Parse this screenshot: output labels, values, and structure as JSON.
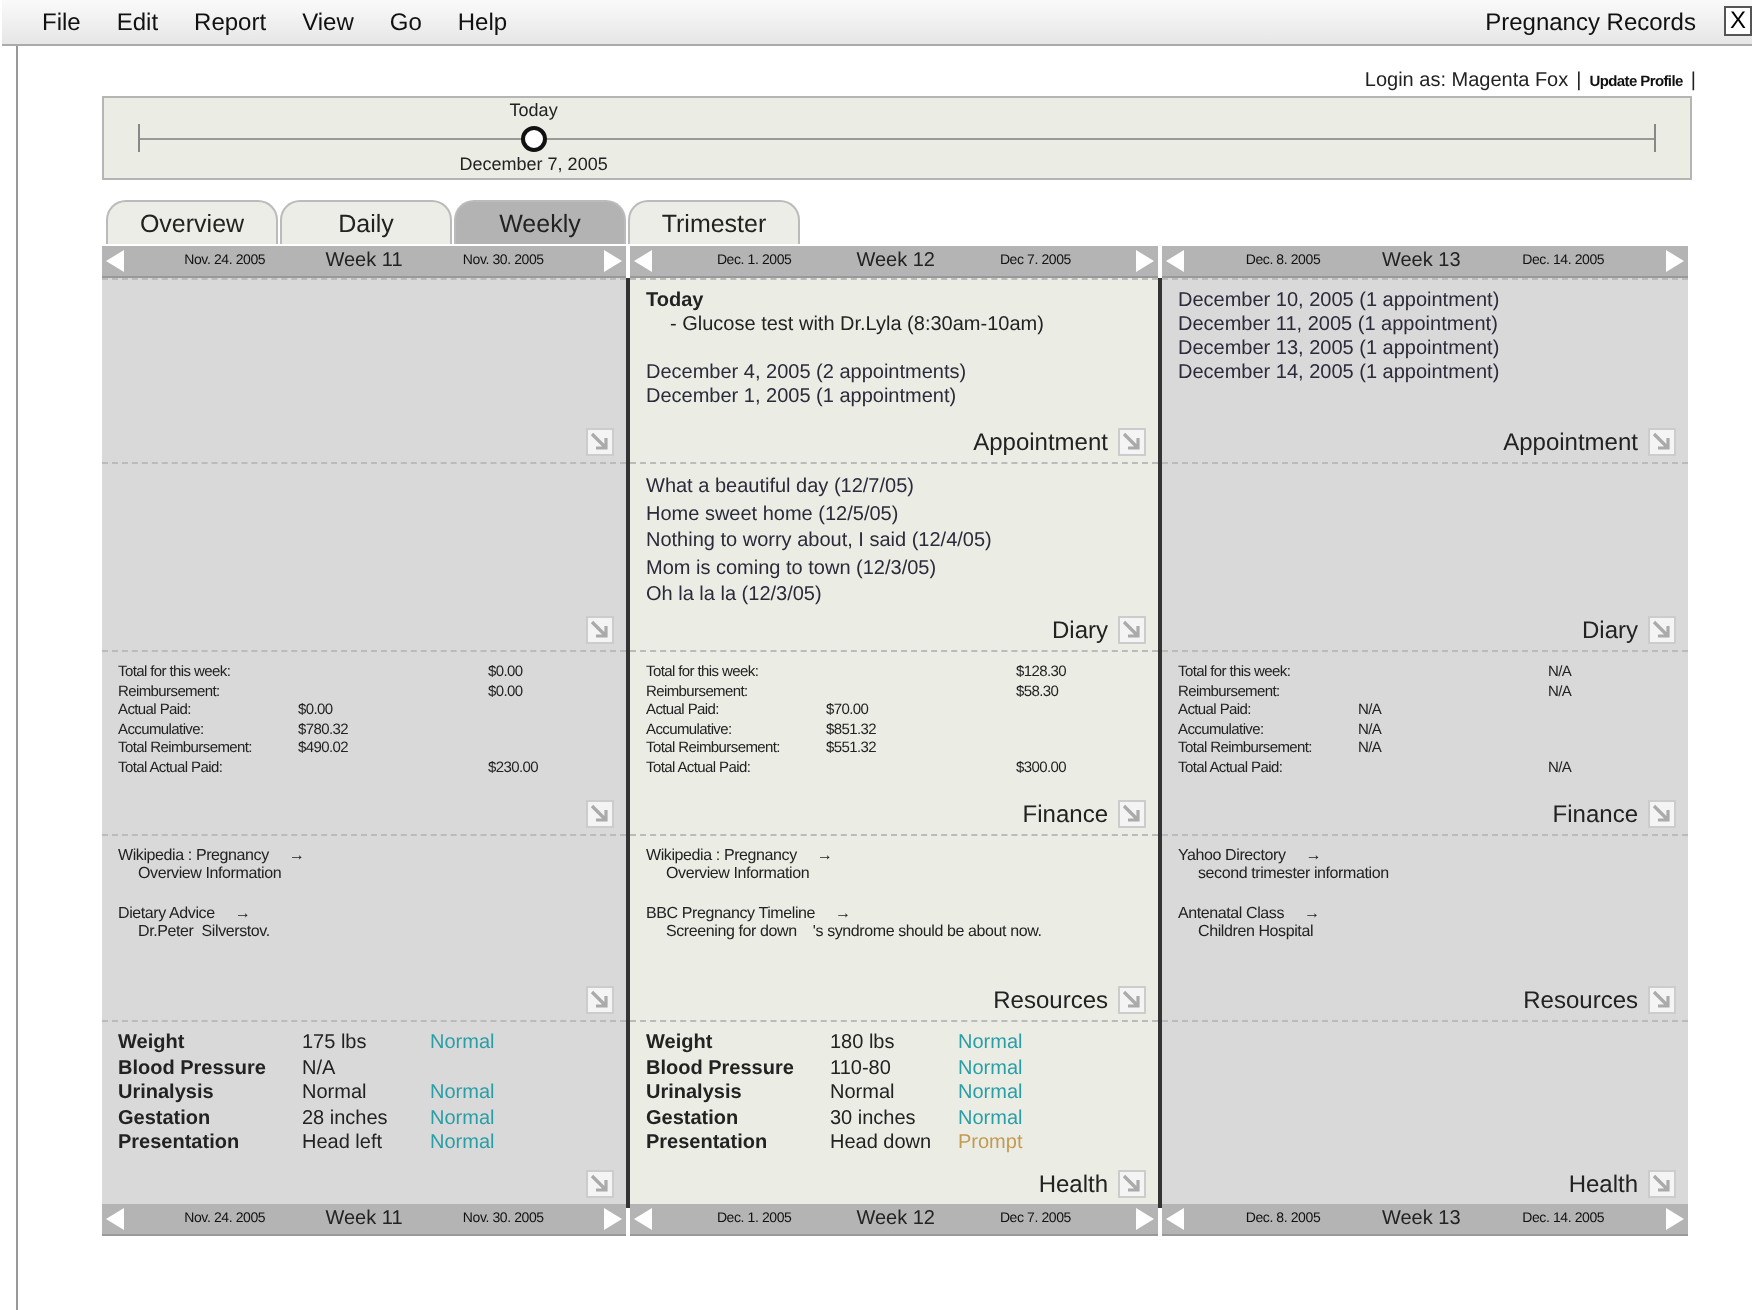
{
  "menu": {
    "items": [
      "File",
      "Edit",
      "Report",
      "View",
      "Go",
      "Help"
    ],
    "title": "Pregnancy Records",
    "close": "X"
  },
  "login": {
    "text": "Login as: Magenta Fox",
    "separator_1": "|",
    "link": "Update Profile",
    "separator_2": "|"
  },
  "timeline": {
    "label": "Today",
    "date": "December 7, 2005",
    "level": 0.26
  },
  "tabs": [
    {
      "label": "Overview",
      "selected": false
    },
    {
      "label": "Daily",
      "selected": false
    },
    {
      "label": "Weekly",
      "selected": true
    },
    {
      "label": "Trimester",
      "selected": false
    }
  ],
  "weeks": [
    {
      "selected": false,
      "header": {
        "start": "Nov. 24. 2005",
        "week": "Week 11",
        "end": "Nov. 30. 2005"
      },
      "finance": {
        "rows": [
          {
            "label": "Total for this week:",
            "value": "$0.00",
            "kind": "right"
          },
          {
            "label": "Reimbursement:",
            "value": "$0.00",
            "kind": "right"
          },
          {
            "label": "Actual Paid:",
            "value": "$0.00",
            "kind": "mid"
          },
          {
            "label": "Accumulative:",
            "value": "$780.32",
            "kind": "mid"
          },
          {
            "label": "Total Reimbursement:",
            "value": "$490.02",
            "kind": "mid"
          },
          {
            "label": "Total Actual Paid:",
            "value": "$230.00",
            "kind": "right"
          }
        ]
      },
      "resources": {
        "items": [
          {
            "title": "Wikipedia : Pregnancy",
            "arrow": "→",
            "description": "Overview Information"
          },
          {
            "title": "Dietary Advice",
            "arrow": "→",
            "description": "Dr.Peter  Silverstov."
          }
        ]
      },
      "health": {
        "rows": [
          {
            "label": "Weight",
            "value": "175 lbs",
            "status": "Normal",
            "kind": "normal"
          },
          {
            "label": "Blood Pressure",
            "value": "N/A"
          },
          {
            "label": "Urinalysis",
            "value": "Normal",
            "status": "Normal",
            "kind": "normal"
          },
          {
            "label": "Gestation",
            "value": "28 inches",
            "status": "Normal",
            "kind": "normal"
          },
          {
            "label": "Presentation",
            "value": "Head left",
            "status": "Normal",
            "kind": "normal"
          }
        ]
      },
      "footer": {
        "start": "Nov. 24. 2005",
        "week": "Week 11",
        "end": "Nov. 30. 2005"
      }
    },
    {
      "selected": true,
      "header": {
        "start": "Dec. 1. 2005",
        "week": "Week 12",
        "end": "Dec 7. 2005"
      },
      "appointment": {
        "title": "Appointment",
        "today": {
          "label": "Today",
          "items": [
            "- Glucose test with Dr.Lyla (8:30am-10am)"
          ]
        },
        "items": [
          "December 4, 2005 (2 appointments)",
          "December 1, 2005 (1 appointment)"
        ]
      },
      "diary": {
        "title": "Diary",
        "entries": [
          "What a beautiful day (12/7/05)",
          "Home sweet home (12/5/05)",
          "Nothing to worry about, I said (12/4/05)",
          "Mom is coming to town (12/3/05)",
          "Oh la la la (12/3/05)"
        ]
      },
      "finance": {
        "title": "Finance",
        "rows": [
          {
            "label": "Total for this week:",
            "value": "$128.30",
            "kind": "right"
          },
          {
            "label": "Reimbursement:",
            "value": "$58.30",
            "kind": "right"
          },
          {
            "label": "Actual Paid:",
            "value": "$70.00",
            "kind": "mid"
          },
          {
            "label": "Accumulative:",
            "value": "$851.32",
            "kind": "mid"
          },
          {
            "label": "Total Reimbursement:",
            "value": "$551.32",
            "kind": "mid"
          },
          {
            "label": "Total Actual Paid:",
            "value": "$300.00",
            "kind": "right"
          }
        ]
      },
      "resources": {
        "title": "Resources",
        "items": [
          {
            "title": "Wikipedia : Pregnancy",
            "arrow": "→",
            "description": "Overview Information"
          },
          {
            "title": "BBC Pregnancy Timeline",
            "arrow": "→",
            "description": "Screening for down    's syndrome should be about now."
          }
        ]
      },
      "health": {
        "title": "Health",
        "rows": [
          {
            "label": "Weight",
            "value": "180 lbs",
            "status": "Normal",
            "kind": "normal"
          },
          {
            "label": "Blood Pressure",
            "value": "110-80",
            "status": "Normal",
            "kind": "normal"
          },
          {
            "label": "Urinalysis",
            "value": "Normal",
            "status": "Normal",
            "kind": "normal"
          },
          {
            "label": "Gestation",
            "value": "30 inches",
            "status": "Normal",
            "kind": "normal"
          },
          {
            "label": "Presentation",
            "value": "Head down",
            "status": "Prompt",
            "kind": "prompt"
          }
        ]
      },
      "footer": {
        "start": "Dec. 1. 2005",
        "week": "Week 12",
        "end": "Dec 7. 2005"
      }
    },
    {
      "selected": false,
      "header": {
        "start": "Dec. 8. 2005",
        "week": "Week 13",
        "end": "Dec. 14. 2005"
      },
      "appointment": {
        "title": "Appointment",
        "items": [
          "December 10, 2005 (1 appointment)",
          "December 11, 2005 (1 appointment)",
          "December 13, 2005 (1 appointment)",
          "December 14, 2005 (1 appointment)"
        ]
      },
      "diary": {
        "title": "Diary"
      },
      "finance": {
        "title": "Finance",
        "rows": [
          {
            "label": "Total for this week:",
            "value": "N/A",
            "kind": "right"
          },
          {
            "label": "Reimbursement:",
            "value": "N/A",
            "kind": "right"
          },
          {
            "label": "Actual Paid:",
            "value": "N/A",
            "kind": "mid"
          },
          {
            "label": "Accumulative:",
            "value": "N/A",
            "kind": "mid"
          },
          {
            "label": "Total Reimbursement:",
            "value": "N/A",
            "kind": "mid"
          },
          {
            "label": "Total Actual Paid:",
            "value": "N/A",
            "kind": "right"
          }
        ]
      },
      "resources": {
        "title": "Resources",
        "items": [
          {
            "title": "Yahoo Directory",
            "arrow": "→",
            "description": "second trimester information"
          },
          {
            "title": "Antenatal Class",
            "arrow": "→",
            "description": "Children Hospital"
          }
        ]
      },
      "health": {
        "title": "Health"
      },
      "footer": {
        "start": "Dec. 8. 2005",
        "week": "Week 13",
        "end": "Dec. 14. 2005"
      }
    }
  ]
}
